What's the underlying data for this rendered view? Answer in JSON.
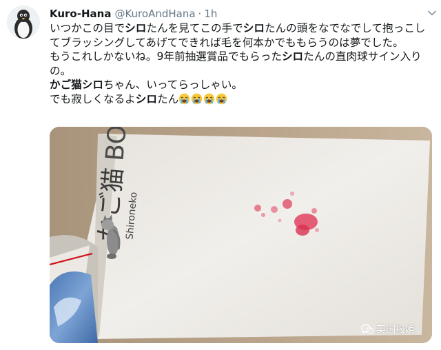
{
  "tweet": {
    "display_name": "Kuro-Hana",
    "handle": "@KuroAndHana",
    "separator": "·",
    "time": "1h",
    "lines": [
      {
        "segments": [
          {
            "text": "いつかこの目で"
          },
          {
            "text": "シロ",
            "bold": true
          },
          {
            "text": "たんを見てこの手で"
          },
          {
            "text": "シロ",
            "bold": true
          },
          {
            "text": "たんの頭をなでなでして抱っこしてブラッシングしてあげてできれば毛を何本かでももらうのは夢でした。"
          }
        ]
      },
      {
        "segments": [
          {
            "text": "もうこれしかないね。9年前抽選賞品でもらった"
          },
          {
            "text": "シロ",
            "bold": true
          },
          {
            "text": "たんの直肉球サイン入りの。"
          }
        ]
      },
      {
        "segments": [
          {
            "text": "かご猫シロ",
            "bold": true
          },
          {
            "text": "ちゃん、いってらっしゃい。"
          }
        ]
      },
      {
        "segments": [
          {
            "text": "でも寂しくなるよ"
          },
          {
            "text": "シロ",
            "bold": true
          },
          {
            "text": "たん"
          }
        ],
        "emoji": [
          "loudly-crying-face",
          "loudly-crying-face",
          "loudly-crying-face",
          "loudly-crying-face"
        ]
      }
    ]
  },
  "media": {
    "book_title": "かご猫",
    "book_subtitle": "Shironeko",
    "book_title_suffix": "BO",
    "paw_print_color": "#e0435f"
  },
  "watermark": {
    "icon": "wechat-icon",
    "label": "英国报姐"
  },
  "colors": {
    "text": "#14171a",
    "secondary": "#657786"
  }
}
